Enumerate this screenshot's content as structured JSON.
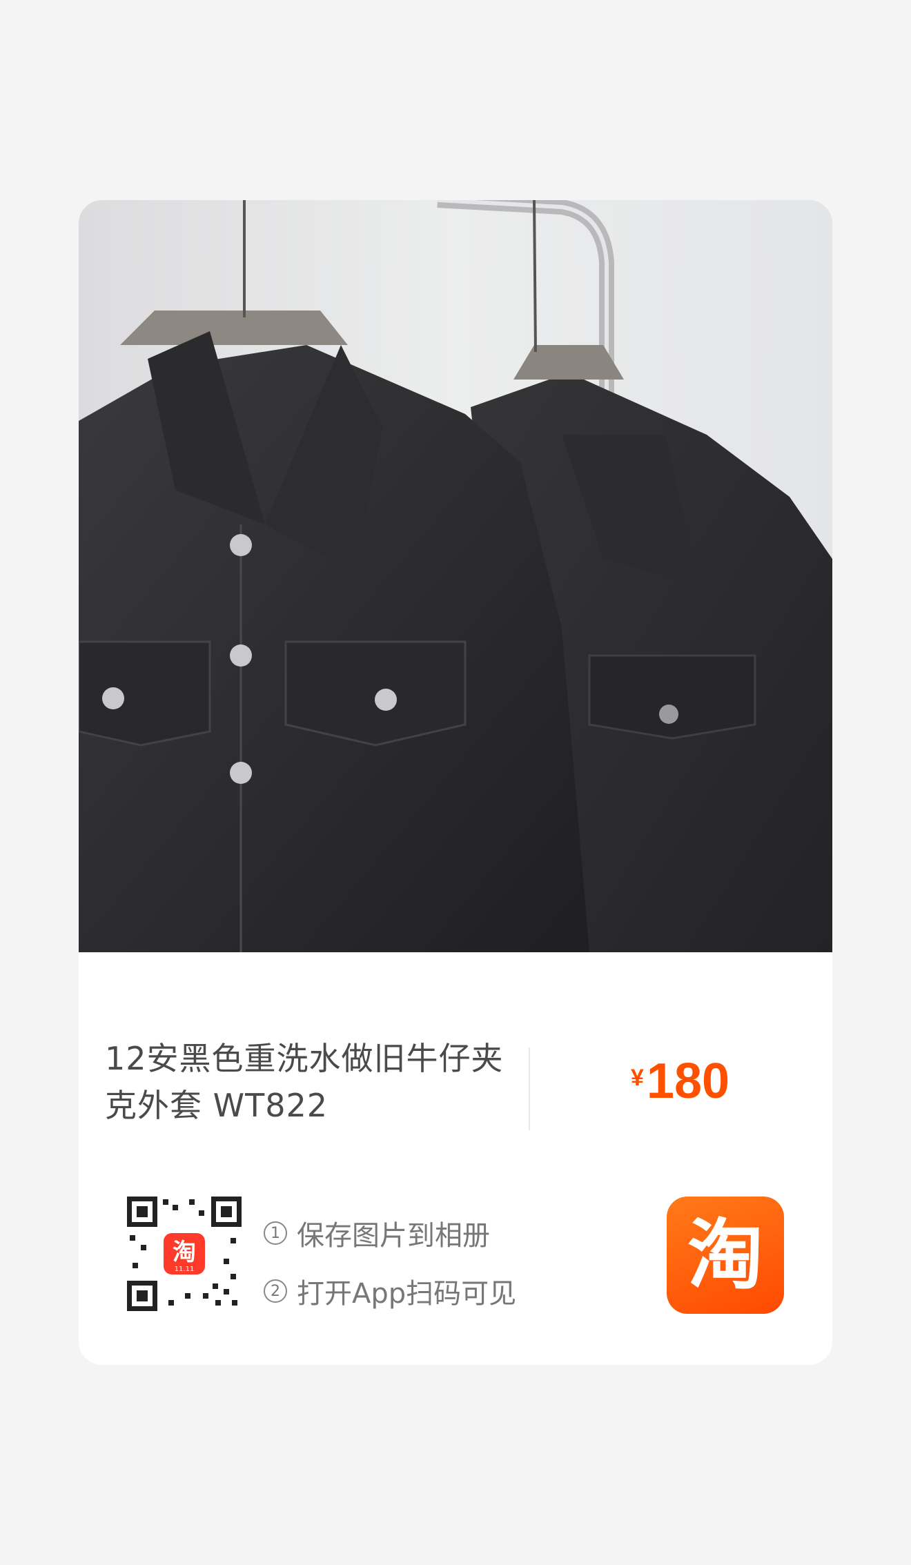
{
  "product": {
    "title": "12安黑色重洗水做旧牛仔夹克外套 WT822",
    "price_symbol": "¥",
    "price_value": "180"
  },
  "share": {
    "steps": [
      {
        "index": "1",
        "text": "保存图片到相册"
      },
      {
        "index": "2",
        "text": "打开App扫码可见"
      }
    ],
    "qr_badge_text": "淘",
    "qr_badge_sub": "11.11",
    "app_logo_char": "淘"
  },
  "colors": {
    "price": "#ff5000",
    "app_logo": "#ff5a00",
    "background": "#f4f4f4"
  }
}
